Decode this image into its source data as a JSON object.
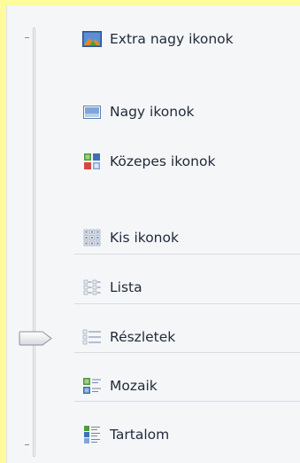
{
  "view_menu": {
    "items": [
      {
        "label": "Extra nagy ikonok",
        "icon": "extra-large-icons-icon"
      },
      {
        "label": "Nagy ikonok",
        "icon": "large-icons-icon"
      },
      {
        "label": "Közepes ikonok",
        "icon": "medium-icons-icon"
      },
      {
        "label": "Kis ikonok",
        "icon": "small-icons-icon"
      },
      {
        "label": "Lista",
        "icon": "list-icon"
      },
      {
        "label": "Részletek",
        "icon": "details-icon"
      },
      {
        "label": "Mozaik",
        "icon": "tiles-icon"
      },
      {
        "label": "Tartalom",
        "icon": "content-icon"
      }
    ],
    "selected_item": "Részletek"
  },
  "colors": {
    "background_frame": "#fdfb9c",
    "menu_background": "#f5f6f8",
    "label_text": "#1f2a3a"
  }
}
